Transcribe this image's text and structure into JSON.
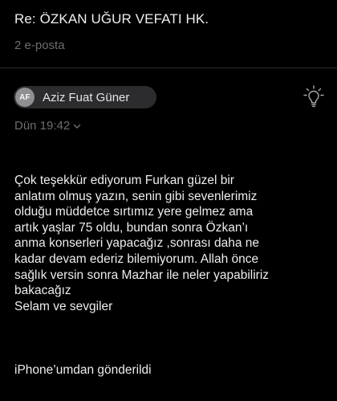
{
  "email": {
    "subject": "Re: ÖZKAN UĞUR VEFATI HK.",
    "thread_count": "2 e-posta",
    "sender": {
      "initials": "AF",
      "name": "Aziz Fuat Güner"
    },
    "date": "Dün 19:42",
    "body_lines": [
      "Çok teşekkür ediyorum Furkan güzel bir",
      "anlatım olmuş yazın, senin gibi sevenlerimiz",
      "olduğu müddetce sırtımız yere gelmez ama",
      "artık yaşlar 75 oldu, bundan sonra Özkan’ı",
      "anma konserleri yapacağız ,sonrası daha ne",
      "kadar devam ederiz bilemiyorum. Allah önce",
      "sağlık versin sonra Mazhar ile neler yapabiliriz",
      "bakacağız",
      "Selam ve sevgiler"
    ],
    "signature": "iPhone’umdan gönderildi"
  },
  "icons": {
    "bulb": "lightbulb-icon",
    "chevron": "chevron-down-icon"
  },
  "colors": {
    "background": "#000000",
    "text_primary": "#ededf0",
    "text_secondary": "#6d6d72",
    "chip_background": "#2c2c2e",
    "avatar_background": "#8e8e93"
  }
}
